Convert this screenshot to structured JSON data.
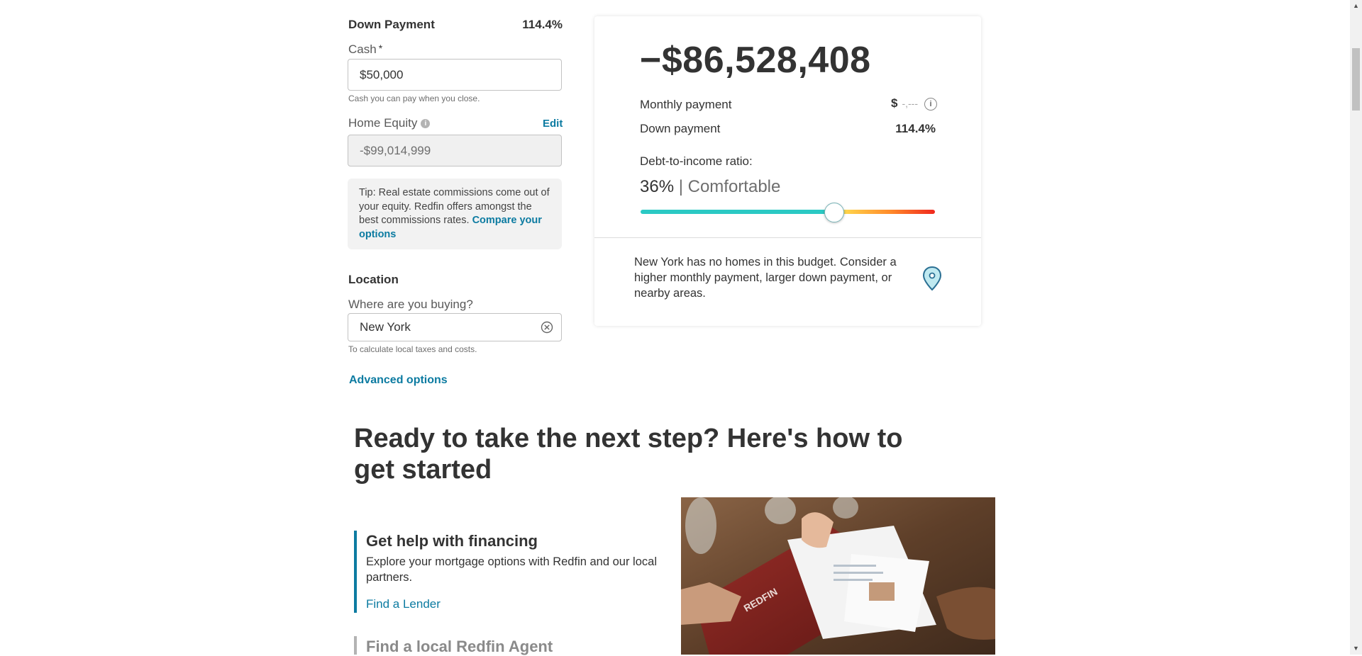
{
  "down_payment": {
    "title": "Down Payment",
    "percent": "114.4%",
    "cash_label": "Cash",
    "cash_required_mark": "*",
    "cash_value": "$50,000",
    "cash_hint": "Cash you can pay when you close.",
    "equity_label": "Home Equity",
    "equity_edit": "Edit",
    "equity_value": "-$99,014,999",
    "tip_text": "Tip: Real estate commissions come out of your equity. Redfin offers amongst the best commissions rates. ",
    "tip_link": "Compare your options"
  },
  "location": {
    "title": "Location",
    "label": "Where are you buying?",
    "value": "New York",
    "hint": "To calculate local taxes and costs."
  },
  "advanced_options": "Advanced options",
  "results": {
    "price": "−$86,528,408",
    "monthly_label": "Monthly payment",
    "monthly_currency": "$",
    "monthly_value": "-,---",
    "down_label": "Down payment",
    "down_value": "114.4%",
    "dti_label": "Debt-to-income ratio:",
    "dti_value": "36%",
    "dti_separator": " | ",
    "dti_status": "Comfortable",
    "dti_slider_fraction": 0.655,
    "message": "New York has no homes in this budget. Consider a higher monthly payment, larger down payment, or nearby areas."
  },
  "next_steps": {
    "heading": "Ready to take the next step? Here's how to get started",
    "steps": [
      {
        "title": "Get help with financing",
        "description": "Explore your mortgage options with Redfin and our local partners.",
        "link": "Find a Lender"
      },
      {
        "title": "Find a local Redfin Agent"
      }
    ],
    "photo_brand": "REDFIN"
  },
  "icons": {
    "info": "info-icon",
    "clear": "clear-circle-x-icon",
    "location_pin": "map-pin-icon"
  },
  "colors": {
    "link": "#0c7ba1",
    "slider_start": "#2bc9c4",
    "slider_end": "#f0281e"
  }
}
